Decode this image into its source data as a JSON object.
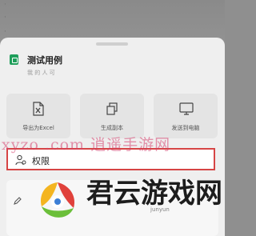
{
  "background": {
    "glyphs": [
      "·",
      "·",
      "·"
    ]
  },
  "file": {
    "title": "测试用例",
    "subtitle": "我 的 人   可"
  },
  "actions": [
    {
      "label": "导出为Excel",
      "icon": "excel-export-icon"
    },
    {
      "label": "生成副本",
      "icon": "copy-icon"
    },
    {
      "label": "发送到电脑",
      "icon": "computer-monitor-icon"
    }
  ],
  "permissions": {
    "label": "权限",
    "icon": "user-permission-icon"
  },
  "watermark": {
    "site": "xyzo .com  逍遥手游网",
    "brand": "君云游戏网",
    "sub": "junyun",
    "colors": {
      "site": "#d5406e",
      "brand": "#1d1d1d"
    }
  },
  "theme": {
    "highlight_border": "#d64545",
    "file_icon": "#1e9e5a",
    "sheet_bg": "#efefef"
  }
}
